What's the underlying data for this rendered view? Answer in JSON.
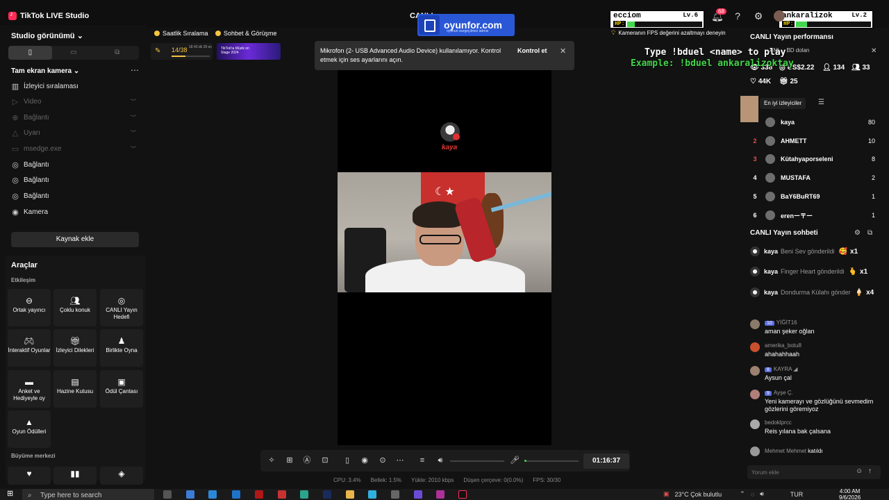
{
  "window": {
    "app_title": "TikTok LIVE Studio",
    "center_title": "CANLI"
  },
  "watermark": {
    "brand": "oyunfor.com",
    "tagline": "oyunun vazgeçilmez adresi"
  },
  "player_cards": [
    {
      "name": "ecciom",
      "level": "Lv.6",
      "hp_label": "HP:",
      "hp_fraction": 0.1
    },
    {
      "name": "ankaralizok",
      "level": "Lv.2",
      "hp_label": "HP:",
      "hp_fraction": 0.15
    }
  ],
  "header": {
    "notification_count": "68"
  },
  "left_panel": {
    "title": "Studio görünümü",
    "scene_name": "Tam ekran kamera",
    "sources": [
      {
        "label": "İzleyici sıralaması",
        "icon": "ranking-icon",
        "dim": false
      },
      {
        "label": "Video",
        "icon": "video-icon",
        "dim": true
      },
      {
        "label": "Bağlantı",
        "icon": "link-icon",
        "dim": true
      },
      {
        "label": "Uyarı",
        "icon": "bell-icon",
        "dim": true
      },
      {
        "label": "msedge.exe",
        "icon": "window-icon",
        "dim": true
      },
      {
        "label": "Bağlantı",
        "icon": "globe-icon",
        "dim": false
      },
      {
        "label": "Bağlantı",
        "icon": "globe-icon",
        "dim": false
      },
      {
        "label": "Bağlantı",
        "icon": "globe-icon",
        "dim": false
      },
      {
        "label": "Kamera",
        "icon": "camera-icon",
        "dim": false
      }
    ],
    "add_source_label": "Kaynak ekle",
    "tools_title": "Araçlar",
    "interaction_label": "Etkileşim",
    "growth_label": "Büyüme merkezi",
    "tools": [
      {
        "label": "Ortak yayıncı",
        "icon": "link-icon"
      },
      {
        "label": "Çoklu konuk",
        "icon": "users-icon"
      },
      {
        "label": "CANLI Yayın Hedefi",
        "icon": "target-icon"
      },
      {
        "label": "İnteraktif Oyunlar",
        "icon": "gamepad-icon"
      },
      {
        "label": "İzleyici Dilekleri",
        "icon": "gift-icon"
      },
      {
        "label": "Birlikte Oyna",
        "icon": "play-together-icon"
      },
      {
        "label": "Anket ve Hediyeyle oy",
        "icon": "poll-icon"
      },
      {
        "label": "Hazine Kutusu",
        "icon": "treasure-icon"
      },
      {
        "label": "Ödül Çantası",
        "icon": "bag-icon"
      },
      {
        "label": "Oyun Ödülleri",
        "icon": "trophy-icon"
      }
    ]
  },
  "top_chips": {
    "hourly_ranking": "Saatlik Sıralama",
    "chat_meet": "Sohbet & Görüşme",
    "progress_value": "14/38",
    "progress_fraction": 0.368,
    "progress_time": "18 43 dk 29 sn",
    "banner_text": "TikTok'ta Müzik on Stage 2024"
  },
  "toast": {
    "message": "Mikrofon (2- USB Advanced Audio Device) kullanılamıyor. Kontrol etmek için ses ayarlarını açın.",
    "action": "Kontrol et"
  },
  "preview": {
    "overlay_name": "kaya"
  },
  "overlay_text": {
    "type_line": "Type !bduel <name> to play",
    "example_line": "Example: !bduel ankaralizoktay",
    "fps_warning": "Kameranın FPS değerini azaltmayı deneyin"
  },
  "controls": {
    "timer": "01:16:37",
    "volume_fraction": 0.0,
    "mic_fraction": 0.0
  },
  "status_bar": {
    "cpu": "CPU: 3.4%",
    "memory": "Bellek: 1.5%",
    "upload": "Yükle: 2010 kbps",
    "dropped": "Düşen çerçeve: 0(0.0%)",
    "fps": "FPS: 30/30"
  },
  "right_panel": {
    "title": "CANLI Yayın performansı",
    "banner": "ANL... BD dolan",
    "stats": {
      "viewers": "338",
      "earnings": "US$2.22",
      "new_followers": "134",
      "gifters": "33",
      "likes": "44K",
      "gifts": "25"
    },
    "top_viewers_label": "En iyi izleyiciler",
    "top_viewers": [
      {
        "rank": "",
        "name": "kaya",
        "score": "80"
      },
      {
        "rank": "2",
        "name": "AHMETT",
        "score": "10"
      },
      {
        "rank": "3",
        "name": "Kütahyaporseleni",
        "score": "8"
      },
      {
        "rank": "4",
        "name": "MUSTAFA",
        "score": "2"
      },
      {
        "rank": "5",
        "name": "BaY6BuRT69",
        "score": "1"
      },
      {
        "rank": "6",
        "name": "erenー〒ー",
        "score": "1"
      }
    ],
    "chat_title": "CANLI Yayın sohbeti",
    "gifts": [
      {
        "user": "kaya",
        "text": "Beni Sev gönderildi",
        "icon": "🥰",
        "count": "x1"
      },
      {
        "user": "kaya",
        "text": "Finger Heart gönderildi",
        "icon": "🫰",
        "count": "x1"
      },
      {
        "user": "kaya",
        "text": "Dondurma Külahı gönder",
        "icon": "🍦",
        "count": "x4"
      }
    ],
    "messages": [
      {
        "level": "10",
        "user": "YİĞİT16",
        "text": "aman şeker oğlan"
      },
      {
        "level": "",
        "user": "amerika_botu8",
        "text": "ahahahhaah"
      },
      {
        "level": "8",
        "user": "KAYRA ◢",
        "text": "Aysun çal"
      },
      {
        "level": "9",
        "user": "Ayşe Ç.",
        "text": "Yeni kamerayı ve gözlüğünü sevmedim gözlerini göremiyoz"
      },
      {
        "level": "",
        "user": "bedoklprcc",
        "text": "Reis yılana bak çalsana"
      },
      {
        "level": "",
        "user": "Mehmet Mehmet",
        "text": "katıldı"
      }
    ],
    "comment_placeholder": "Yorum ekle"
  },
  "taskbar": {
    "search_placeholder": "Type here to search",
    "weather": "23°C  Çok bulutlu",
    "language": "TUR",
    "time": "4:00 AM",
    "date": "9/6/2026"
  }
}
